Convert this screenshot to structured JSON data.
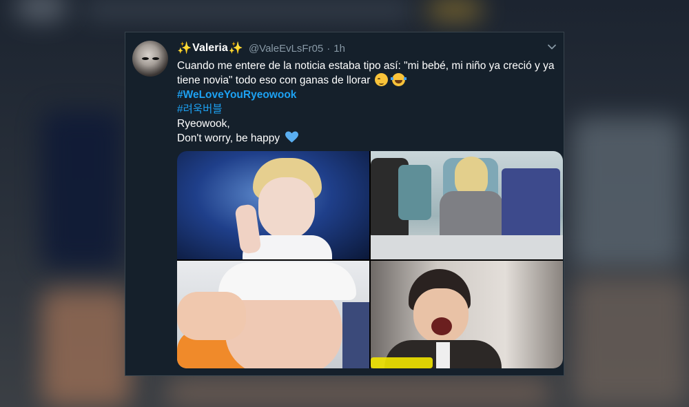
{
  "tweet": {
    "name_prefix_icon": "sparkles-icon",
    "display_name": "Valeria",
    "name_suffix_icon": "sparkles-icon",
    "handle": "@ValeEvLsFr05",
    "separator": "·",
    "time": "1h",
    "text_line1": "Cuando me entere de la noticia estaba tipo así: \"mi bebé, mi niño ya creció y ya tiene novia\" todo eso con ganas de llorar",
    "emojis": [
      "relieved-face-icon",
      "tears-of-joy-icon"
    ],
    "hashtag1": "#WeLoveYouRyeowook",
    "hashtag2": "#려욱버블",
    "line_name": "Ryeowook,",
    "line_message": "Don't worry, be happy",
    "heart_icon": "blue-heart-icon",
    "media": [
      "photo-stage-peace-sign",
      "photo-airplane-seat",
      "photo-white-cap-wink",
      "photo-laughing-elevator"
    ]
  },
  "colors": {
    "background": "#15202b",
    "text": "#ffffff",
    "muted": "#8899a6",
    "link": "#1da1f2",
    "border": "#38444d"
  }
}
